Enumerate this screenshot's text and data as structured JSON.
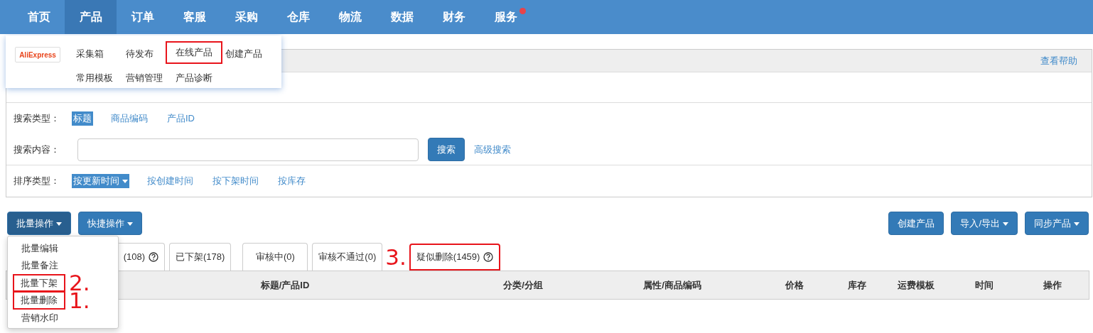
{
  "nav": {
    "items": [
      {
        "label": "首页",
        "selected": false,
        "notification": false
      },
      {
        "label": "产品",
        "selected": true,
        "notification": false
      },
      {
        "label": "订单",
        "selected": false,
        "notification": false
      },
      {
        "label": "客服",
        "selected": false,
        "notification": false
      },
      {
        "label": "采购",
        "selected": false,
        "notification": false
      },
      {
        "label": "仓库",
        "selected": false,
        "notification": false
      },
      {
        "label": "物流",
        "selected": false,
        "notification": false
      },
      {
        "label": "数据",
        "selected": false,
        "notification": false
      },
      {
        "label": "财务",
        "selected": false,
        "notification": false
      },
      {
        "label": "服务",
        "selected": false,
        "notification": true
      }
    ]
  },
  "product_menu": {
    "logo": "AliExpress",
    "items": [
      {
        "label": "采集箱",
        "marked": false
      },
      {
        "label": "待发布",
        "marked": false
      },
      {
        "label": "在线产品",
        "marked": true
      },
      {
        "label": "创建产品",
        "marked": false
      },
      {
        "label": "常用模板",
        "marked": false
      },
      {
        "label": "营销管理",
        "marked": false
      },
      {
        "label": "产品诊断",
        "marked": false
      }
    ]
  },
  "filter_panel": {
    "help_link": "查看帮助",
    "rows": [
      {
        "kind": "covered"
      },
      {
        "kind": "options",
        "label": "搜索类型：",
        "options": [
          {
            "label": "标题",
            "selected": true
          },
          {
            "label": "商品编码",
            "selected": false
          },
          {
            "label": "产品ID",
            "selected": false
          }
        ]
      },
      {
        "kind": "search",
        "label": "搜索内容：",
        "button": "搜索",
        "link": "高级搜索"
      },
      {
        "kind": "options",
        "label": "排序类型：",
        "options": [
          {
            "label": "按更新时间",
            "selected": true
          },
          {
            "label": "按创建时间",
            "selected": false
          },
          {
            "label": "按下架时间",
            "selected": false
          },
          {
            "label": "按库存",
            "selected": false
          }
        ]
      }
    ]
  },
  "toolbar": {
    "left": [
      {
        "label": "批量操作",
        "expanded": true
      },
      {
        "label": "快捷操作",
        "expanded": false
      }
    ],
    "right": [
      {
        "label": "创建产品",
        "caret": false
      },
      {
        "label": "导入/导出",
        "caret": true
      },
      {
        "label": "同步产品",
        "caret": true
      }
    ]
  },
  "batch_menu": {
    "items": [
      {
        "label": "批量编辑",
        "marked": false
      },
      {
        "label": "批量备注",
        "marked": false
      },
      {
        "label": "批量下架",
        "marked": true,
        "annotation": "2."
      },
      {
        "label": "批量删除",
        "marked": true,
        "annotation": "1."
      },
      {
        "label": "营销水印",
        "marked": false
      }
    ]
  },
  "tabs": [
    {
      "label": "(108)",
      "help": true,
      "marked": false
    },
    {
      "label": "已下架(178)",
      "help": false,
      "marked": false
    },
    {
      "label": "审核中(0)",
      "help": false,
      "marked": false
    },
    {
      "label": "审核不通过(0)",
      "help": false,
      "marked": false
    },
    {
      "label": "疑似删除(1459)",
      "help": true,
      "marked": true,
      "annotation": "3."
    }
  ],
  "table": {
    "columns": [
      "标题/产品ID",
      "分类/分组",
      "属性/商品编码",
      "价格",
      "库存",
      "运费模板",
      "时间",
      "操作"
    ]
  }
}
